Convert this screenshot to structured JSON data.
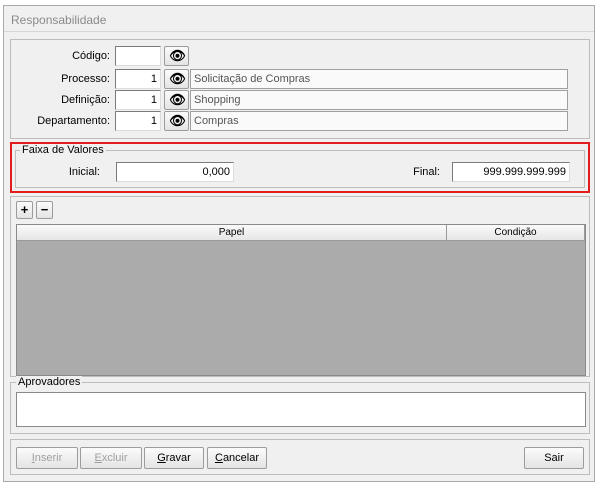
{
  "window": {
    "title": "Responsabilidade"
  },
  "header_fields": {
    "codigo": {
      "label": "Código:",
      "value": ""
    },
    "processo": {
      "label": "Processo:",
      "value": "1",
      "desc": "Solicitação de Compras"
    },
    "definicao": {
      "label": "Definição:",
      "value": "1",
      "desc": "Shopping"
    },
    "departamento": {
      "label": "Departamento:",
      "value": "1",
      "desc": "Compras"
    }
  },
  "faixa": {
    "title": "Faixa de Valores",
    "inicial_label": "Inicial:",
    "inicial_value": "0,000",
    "final_label": "Final:",
    "final_value": "999.999.999.999"
  },
  "grid": {
    "add_label": "+",
    "remove_label": "−",
    "columns": [
      "Papel",
      "Condição"
    ]
  },
  "aprovadores": {
    "title": "Aprovadores",
    "value": ""
  },
  "buttons": {
    "inserir": {
      "key": "I",
      "rest": "nserir"
    },
    "excluir": {
      "key": "E",
      "rest": "xcluir"
    },
    "gravar": {
      "key": "G",
      "rest": "ravar"
    },
    "cancelar": {
      "key": "C",
      "rest": "ancelar"
    },
    "sair": "Sair"
  },
  "icons": {
    "search": "binoculars-icon"
  },
  "colors": {
    "highlight": "#e31d1d",
    "grid_bg": "#ababab"
  }
}
